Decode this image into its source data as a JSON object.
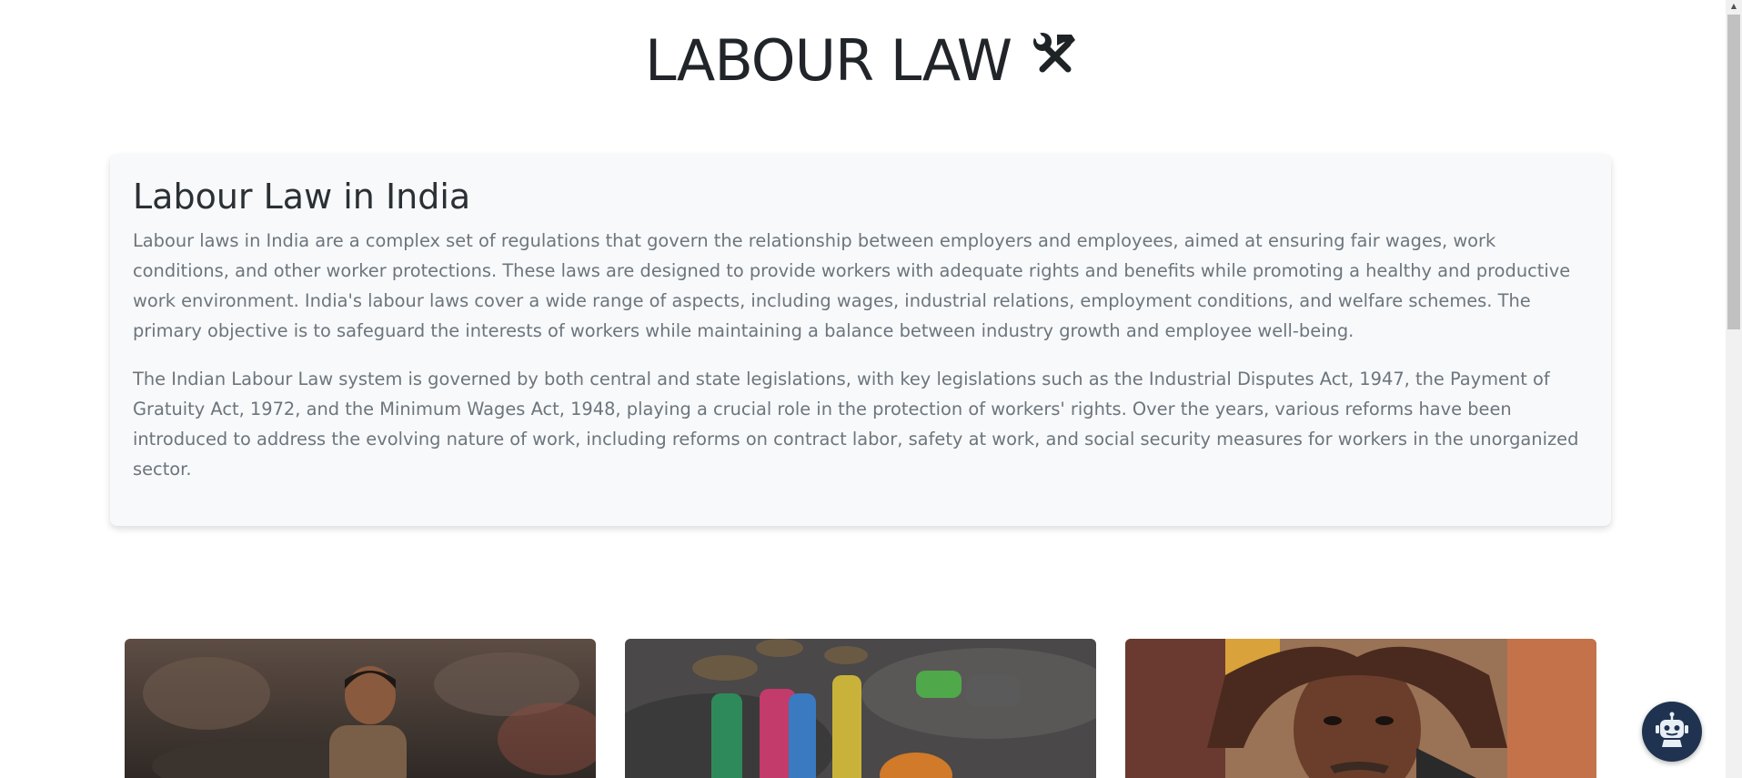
{
  "header": {
    "title": "LABOUR LAW",
    "title_icon": "hammer-and-wrench-icon"
  },
  "intro": {
    "heading": "Labour Law in India",
    "paragraphs": [
      "Labour laws in India are a complex set of regulations that govern the relationship between employers and employees, aimed at ensuring fair wages, work conditions, and other worker protections. These laws are designed to provide workers with adequate rights and benefits while promoting a healthy and productive work environment. India's labour laws cover a wide range of aspects, including wages, industrial relations, employment conditions, and welfare schemes. The primary objective is to safeguard the interests of workers while maintaining a balance between industry growth and employee well-being.",
      "The Indian Labour Law system is governed by both central and state legislations, with key legislations such as the Industrial Disputes Act, 1947, the Payment of Gratuity Act, 1972, and the Minimum Wages Act, 1948, playing a crucial role in the protection of workers' rights. Over the years, various reforms have been introduced to address the evolving nature of work, including reforms on contract labor, safety at work, and social security measures for workers in the unorganized sector."
    ]
  },
  "gallery": {
    "images": [
      "child-worker-photo",
      "coal-workers-photo",
      "worker-portrait-photo"
    ]
  },
  "chatbot": {
    "icon": "robot-icon"
  },
  "colors": {
    "title": "#212529",
    "card_background": "#f8f9fa",
    "paragraph_text": "#6c757d",
    "chatbot_background": "#1f3350"
  }
}
